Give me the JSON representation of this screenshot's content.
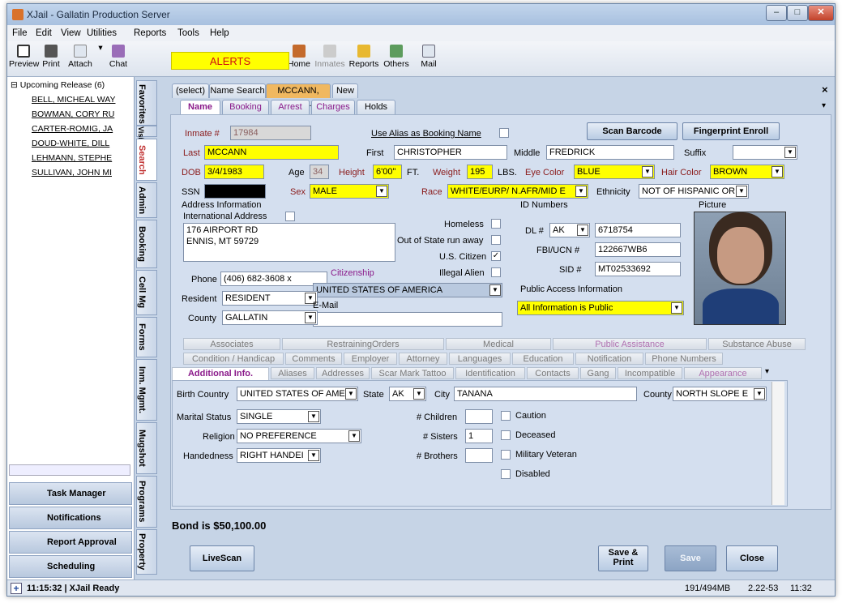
{
  "window": {
    "title": "XJail - Gallatin Production Server"
  },
  "menu": [
    "File",
    "Edit",
    "View",
    "Utilities",
    "Reports",
    "Tools",
    "Help"
  ],
  "toolbar": {
    "preview": "Preview",
    "print": "Print",
    "attach": "Attach",
    "chat": "Chat",
    "alerts": "ALERTS",
    "home": "Home",
    "inmates": "Inmates",
    "reports": "Reports",
    "others": "Others",
    "mail": "Mail"
  },
  "release_list": {
    "header": "Upcoming Release (6)",
    "items": [
      "BELL, MICHEAL WAY",
      "BOWMAN, CORY RU",
      "CARTER-ROMIG, JA",
      "DOUD-WHITE, DILL",
      "LEHMANN, STEPHE",
      "SULLIVAN, JOHN MI"
    ]
  },
  "nav_buttons": [
    "Task Manager",
    "Notifications",
    "Report Approval",
    "Scheduling"
  ],
  "vertical_tabs": [
    "Favorites",
    "Visitation",
    "Search",
    "Admin",
    "Booking",
    "Cell Mg",
    "Forms",
    "Inm. Mgmt.",
    "Mugshot",
    "Programs",
    "Property"
  ],
  "doc_tabs": [
    "(select)",
    "Name Search",
    "MCCANN, CHRI..",
    "New"
  ],
  "record_tabs": [
    "Name",
    "Booking",
    "Arrest",
    "Charges",
    "Holds"
  ],
  "form": {
    "inmate_label": "Inmate #",
    "inmate": "17984",
    "use_alias_label": "Use Alias as Booking Name",
    "scan_barcode": "Scan Barcode",
    "fingerprint": "Fingerprint Enroll",
    "last_label": "Last",
    "last": "MCCANN",
    "first_label": "First",
    "first": "CHRISTOPHER",
    "middle_label": "Middle",
    "middle": "FREDRICK",
    "suffix_label": "Suffix",
    "suffix": "",
    "dob_label": "DOB",
    "dob": "3/4/1983",
    "age_label": "Age",
    "age": "34",
    "height_label": "Height",
    "height": "6'00\"",
    "ft": "FT.",
    "weight_label": "Weight",
    "weight": "195",
    "lbs": "LBS.",
    "eye_label": "Eye Color",
    "eye": "BLUE",
    "hair_label": "Hair Color",
    "hair": "BROWN",
    "ssn_label": "SSN",
    "sex_label": "Sex",
    "sex": "MALE",
    "race_label": "Race",
    "race": "WHITE/EURP/ N.AFR/MID E",
    "eth_label": "Ethnicity",
    "eth": "NOT OF HISPANIC ORIGI",
    "addr_title": "Address Information",
    "intl_label": "International Address",
    "address1": "176 AIRPORT RD",
    "address2": "ENNIS, MT 59729",
    "homeless_label": "Homeless",
    "runaway_label": "Out of State run away",
    "uscit_label": "U.S. Citizen",
    "illegal_label": "Illegal Alien",
    "phone_label": "Phone",
    "phone": "(406) 682-3608 x",
    "citizenship_label": "Citizenship",
    "citizenship": "UNITED STATES OF AMERICA",
    "resident_label": "Resident",
    "resident": "RESIDENT",
    "county_label": "County",
    "county": "GALLATIN",
    "email_label": "E-Mail",
    "email": "",
    "id_title": "ID Numbers",
    "dl_label": "DL #",
    "dl_state": "AK",
    "dl": "6718754",
    "fbi_label": "FBI/UCN #",
    "fbi": "122667WB6",
    "sid_label": "SID #",
    "sid": "MT02533692",
    "public_title": "Public Access Information",
    "public": "All Information is Public",
    "picture_label": "Picture"
  },
  "subtabs_row1": [
    "Associates",
    "RestrainingOrders",
    "Medical",
    "Public Assistance",
    "Substance Abuse"
  ],
  "subtabs_row2": [
    "Condition / Handicap",
    "Comments",
    "Employer",
    "Attorney",
    "Languages",
    "Education",
    "Notification",
    "Phone Numbers"
  ],
  "subtabs_row3": [
    "Additional Info.",
    "Aliases",
    "Addresses",
    "Scar Mark Tattoo",
    "Identification",
    "Contacts",
    "Gang",
    "Incompatible",
    "Appearance"
  ],
  "additional": {
    "birth_country_label": "Birth Country",
    "birth_country": "UNITED STATES OF AME",
    "state_label": "State",
    "state": "AK",
    "city_label": "City",
    "city": "TANANA",
    "county_label": "County",
    "county": "NORTH SLOPE E",
    "marital_label": "Marital Status",
    "marital": "SINGLE",
    "religion_label": "Religion",
    "religion": "NO PREFERENCE",
    "hand_label": "Handedness",
    "hand": "RIGHT HANDEI",
    "children_label": "# Children",
    "children": "",
    "sisters_label": "# Sisters",
    "sisters": "1",
    "brothers_label": "# Brothers",
    "brothers": "",
    "caution": "Caution",
    "deceased": "Deceased",
    "veteran": "Military Veteran",
    "disabled": "Disabled"
  },
  "bond": "Bond is $50,100.00",
  "buttons": {
    "livescan": "LiveScan",
    "save_print": "Save & Print",
    "save": "Save",
    "close": "Close"
  },
  "status": {
    "text": "11:15:32 | XJail Ready",
    "memory": "191/494MB",
    "code": "2.22-53",
    "time": "11:32"
  }
}
